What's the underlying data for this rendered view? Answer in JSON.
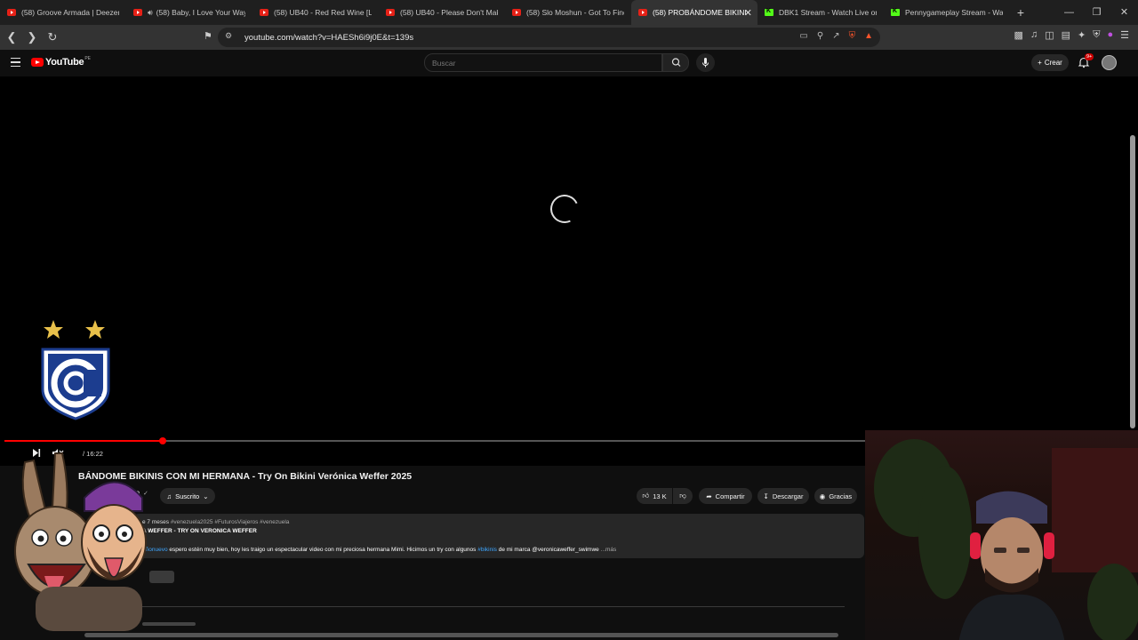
{
  "browser": {
    "tabs": [
      {
        "title": "(58) Groove Armada | Deezer R",
        "type": "yt"
      },
      {
        "title": "(58) Baby, I Love Your Way",
        "type": "yt",
        "speaker": true
      },
      {
        "title": "(58) UB40 - Red Red Wine [Loo",
        "type": "yt"
      },
      {
        "title": "(58) UB40 - Please Don't Make",
        "type": "yt"
      },
      {
        "title": "(58) Slo Moshun - Got To Find",
        "type": "yt"
      },
      {
        "title": "(58) PROBÁNDOME BIKINI",
        "type": "yt",
        "active": true
      },
      {
        "title": "DBK1 Stream - Watch Live on K",
        "type": "kick"
      },
      {
        "title": "Pennygameplay Stream - Watc",
        "type": "kick"
      }
    ],
    "new_tab": "+",
    "url": "youtube.com/watch?v=HAESh6i9j0E&t=139s"
  },
  "youtube": {
    "logo": "YouTube",
    "country": "PE",
    "search_placeholder": "Buscar",
    "create_label": "Crear",
    "notif_count": "9+"
  },
  "player": {
    "progress": 0.141,
    "time": "/ 16:22"
  },
  "video": {
    "title": "BÁNDOME BIKINIS CON MI HERMANA - Try On Bikini Verónica Weffer 2025",
    "channel_partial": "ro",
    "subscribed_label": "Suscrito",
    "likes": "13 K",
    "share_label": "Compartir",
    "download_label": "Descargar",
    "thanks_label": "Gracias"
  },
  "description": {
    "age": "e 7 meses",
    "tags": "#venezuela2025 #FuturosViajeros #venezuela",
    "line2": "A WEFFER - TRY ON VERONICA WEFFER",
    "link1": "eñonuevo",
    "body": " espero estén muy bien, hoy les traigo un espectacular video con mi preciosa hermana Mimi. Hicimos un try con algunos ",
    "link2": "#bikinis",
    "body2": " de mi marca @veronicaweffer_swimwe",
    "more": "...más"
  }
}
